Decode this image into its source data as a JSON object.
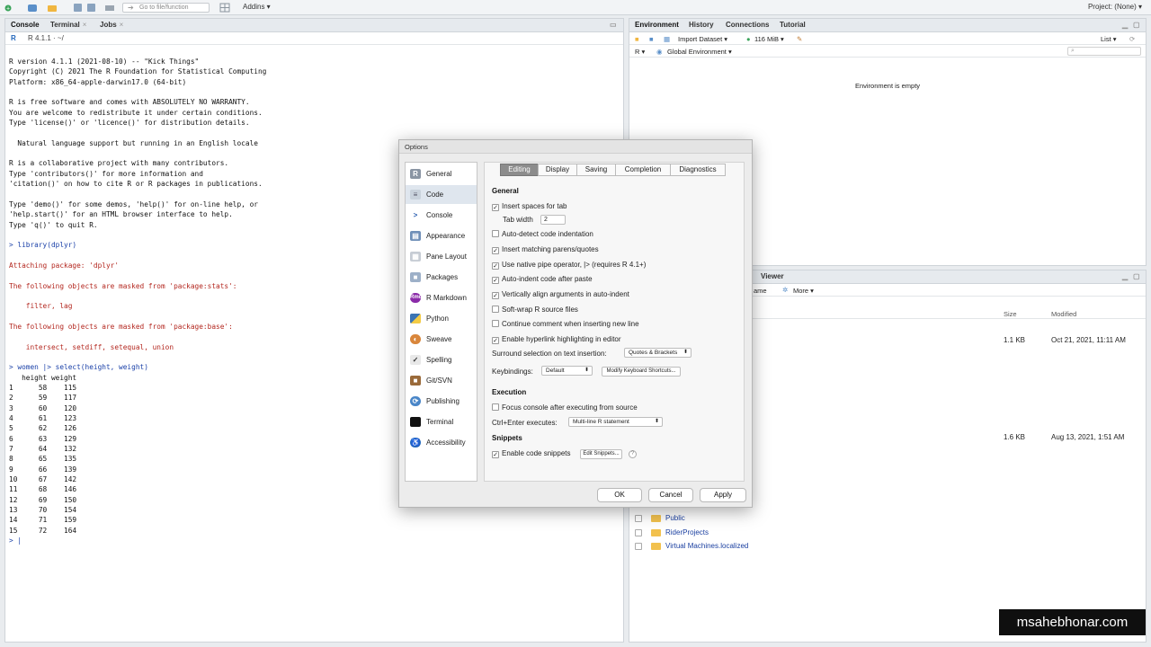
{
  "toolbar": {
    "goto_placeholder": "Go to file/function",
    "addins_label": "Addins ▾",
    "project_label": "Project: (None) ▾"
  },
  "console": {
    "tabs": [
      "Console",
      "Terminal",
      "Jobs"
    ],
    "r_version": "R 4.1.1",
    "path": "· ~/",
    "lines": [
      {
        "t": "R version 4.1.1 (2021-08-10) -- \"Kick Things\"",
        "k": "out"
      },
      {
        "t": "Copyright (C) 2021 The R Foundation for Statistical Computing",
        "k": "out"
      },
      {
        "t": "Platform: x86_64-apple-darwin17.0 (64-bit)",
        "k": "out"
      },
      {
        "t": "",
        "k": "out"
      },
      {
        "t": "R is free software and comes with ABSOLUTELY NO WARRANTY.",
        "k": "out"
      },
      {
        "t": "You are welcome to redistribute it under certain conditions.",
        "k": "out"
      },
      {
        "t": "Type 'license()' or 'licence()' for distribution details.",
        "k": "out"
      },
      {
        "t": "",
        "k": "out"
      },
      {
        "t": "  Natural language support but running in an English locale",
        "k": "out"
      },
      {
        "t": "",
        "k": "out"
      },
      {
        "t": "R is a collaborative project with many contributors.",
        "k": "out"
      },
      {
        "t": "Type 'contributors()' for more information and",
        "k": "out"
      },
      {
        "t": "'citation()' on how to cite R or R packages in publications.",
        "k": "out"
      },
      {
        "t": "",
        "k": "out"
      },
      {
        "t": "Type 'demo()' for some demos, 'help()' for on-line help, or",
        "k": "out"
      },
      {
        "t": "'help.start()' for an HTML browser interface to help.",
        "k": "out"
      },
      {
        "t": "Type 'q()' to quit R.",
        "k": "out"
      },
      {
        "t": "",
        "k": "out"
      },
      {
        "t": "> library(dplyr)",
        "k": "cmd"
      },
      {
        "t": "",
        "k": "out"
      },
      {
        "t": "Attaching package: 'dplyr'",
        "k": "msg"
      },
      {
        "t": "",
        "k": "out"
      },
      {
        "t": "The following objects are masked from 'package:stats':",
        "k": "msg"
      },
      {
        "t": "",
        "k": "out"
      },
      {
        "t": "    filter, lag",
        "k": "msg"
      },
      {
        "t": "",
        "k": "out"
      },
      {
        "t": "The following objects are masked from 'package:base':",
        "k": "msg"
      },
      {
        "t": "",
        "k": "out"
      },
      {
        "t": "    intersect, setdiff, setequal, union",
        "k": "msg"
      },
      {
        "t": "",
        "k": "out"
      },
      {
        "t": "> women |> select(height, weight)",
        "k": "cmd"
      },
      {
        "t": "   height weight",
        "k": "out"
      },
      {
        "t": "1      58    115",
        "k": "out"
      },
      {
        "t": "2      59    117",
        "k": "out"
      },
      {
        "t": "3      60    120",
        "k": "out"
      },
      {
        "t": "4      61    123",
        "k": "out"
      },
      {
        "t": "5      62    126",
        "k": "out"
      },
      {
        "t": "6      63    129",
        "k": "out"
      },
      {
        "t": "7      64    132",
        "k": "out"
      },
      {
        "t": "8      65    135",
        "k": "out"
      },
      {
        "t": "9      66    139",
        "k": "out"
      },
      {
        "t": "10     67    142",
        "k": "out"
      },
      {
        "t": "11     68    146",
        "k": "out"
      },
      {
        "t": "12     69    150",
        "k": "out"
      },
      {
        "t": "13     70    154",
        "k": "out"
      },
      {
        "t": "14     71    159",
        "k": "out"
      },
      {
        "t": "15     72    164",
        "k": "out"
      },
      {
        "t": "> |",
        "k": "prompt"
      }
    ]
  },
  "environment": {
    "tabs": [
      "Environment",
      "History",
      "Connections",
      "Tutorial"
    ],
    "import_dataset": "Import Dataset ▾",
    "memory": "116 MiB ▾",
    "view_mode": "List ▾",
    "language": "R ▾",
    "scope": "Global Environment ▾",
    "empty_message": "Environment is empty"
  },
  "files": {
    "viewer_tab": "Viewer",
    "name_col": "ame",
    "more_label": "More ▾",
    "size_header": "Size",
    "modified_header": "Modified",
    "rows": [
      {
        "size": "1.1 KB",
        "modified": "Oct 21, 2021, 11:11 AM"
      },
      {
        "size": "1.6 KB",
        "modified": "Aug 13, 2021, 1:51 AM"
      }
    ],
    "folders": [
      "Public",
      "RiderProjects",
      "Virtual Machines.localized"
    ]
  },
  "dialog": {
    "title": "Options",
    "sidebar": [
      "General",
      "Code",
      "Console",
      "Appearance",
      "Pane Layout",
      "Packages",
      "R Markdown",
      "Python",
      "Sweave",
      "Spelling",
      "Git/SVN",
      "Publishing",
      "Terminal",
      "Accessibility"
    ],
    "active_sidebar": "Code",
    "tabs": [
      "Editing",
      "Display",
      "Saving",
      "Completion",
      "Diagnostics"
    ],
    "active_tab": "Editing",
    "general_heading": "General",
    "insert_spaces": "Insert spaces for tab",
    "tab_width_label": "Tab width",
    "tab_width_value": "2",
    "options": [
      {
        "label": "Auto-detect code indentation",
        "checked": false
      },
      {
        "label": "Insert matching parens/quotes",
        "checked": true
      },
      {
        "label": "Use native pipe operator, |> (requires R 4.1+)",
        "checked": true
      },
      {
        "label": "Auto-indent code after paste",
        "checked": true
      },
      {
        "label": "Vertically align arguments in auto-indent",
        "checked": true
      },
      {
        "label": "Soft-wrap R source files",
        "checked": false
      },
      {
        "label": "Continue comment when inserting new line",
        "checked": false
      },
      {
        "label": "Enable hyperlink highlighting in editor",
        "checked": true
      }
    ],
    "surround_label": "Surround selection on text insertion:",
    "surround_value": "Quotes & Brackets",
    "keybindings_label": "Keybindings:",
    "keybindings_value": "Default",
    "modify_shortcuts": "Modify Keyboard Shortcuts...",
    "execution_heading": "Execution",
    "focus_console": "Focus console after executing from source",
    "ctrl_enter_label": "Ctrl+Enter executes:",
    "ctrl_enter_value": "Multi-line R statement",
    "snippets_heading": "Snippets",
    "enable_snippets": "Enable code snippets",
    "edit_snippets": "Edit Snippets...",
    "help_icon": "?",
    "ok": "OK",
    "cancel": "Cancel",
    "apply": "Apply"
  },
  "watermark": "msahebhonar.com"
}
